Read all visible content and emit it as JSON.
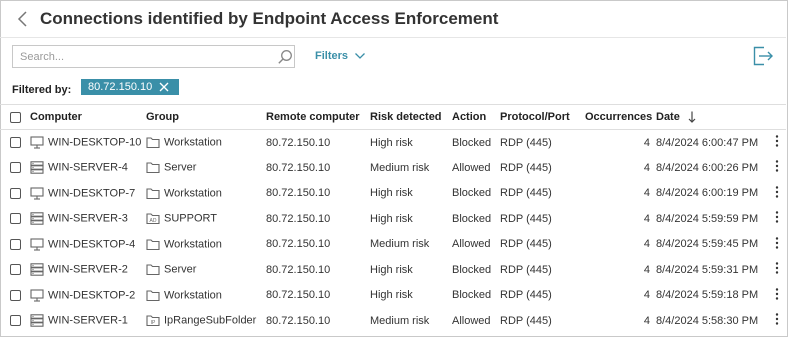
{
  "header": {
    "title": "Connections identified by Endpoint Access Enforcement",
    "back_icon": "chevron-left-icon"
  },
  "toolbar": {
    "search_placeholder": "Search...",
    "search_icon": "search-icon",
    "filters_label": "Filters",
    "filters_icon": "chevron-down-icon",
    "export_icon": "export-icon"
  },
  "filter_bar": {
    "label": "Filtered by:",
    "chip": "80.72.150.10",
    "chip_remove_icon": "close-icon"
  },
  "table": {
    "columns": [
      "Computer",
      "Group",
      "Remote computer",
      "Risk detected",
      "Action",
      "Protocol/Port",
      "Occurrences",
      "Date"
    ],
    "sort_column": "Date",
    "sort_direction": "descending",
    "rows": [
      {
        "computer": "WIN-DESKTOP-10",
        "computer_type": "desktop",
        "group": "Workstation",
        "group_type": "folder",
        "remote": "80.72.150.10",
        "risk": "High risk",
        "action": "Blocked",
        "protocol": "RDP (445)",
        "occurrences": "4",
        "date": "8/4/2024 6:00:47 PM"
      },
      {
        "computer": "WIN-SERVER-4",
        "computer_type": "server",
        "group": "Server",
        "group_type": "folder",
        "remote": "80.72.150.10",
        "risk": "Medium risk",
        "action": "Allowed",
        "protocol": "RDP (445)",
        "occurrences": "4",
        "date": "8/4/2024 6:00:26 PM"
      },
      {
        "computer": "WIN-DESKTOP-7",
        "computer_type": "desktop",
        "group": "Workstation",
        "group_type": "folder",
        "remote": "80.72.150.10",
        "risk": "High risk",
        "action": "Blocked",
        "protocol": "RDP (445)",
        "occurrences": "4",
        "date": "8/4/2024 6:00:19 PM"
      },
      {
        "computer": "WIN-SERVER-3",
        "computer_type": "server",
        "group": "SUPPORT",
        "group_type": "ad",
        "remote": "80.72.150.10",
        "risk": "High risk",
        "action": "Blocked",
        "protocol": "RDP (445)",
        "occurrences": "4",
        "date": "8/4/2024 5:59:59 PM"
      },
      {
        "computer": "WIN-DESKTOP-4",
        "computer_type": "desktop",
        "group": "Workstation",
        "group_type": "folder",
        "remote": "80.72.150.10",
        "risk": "Medium risk",
        "action": "Allowed",
        "protocol": "RDP (445)",
        "occurrences": "4",
        "date": "8/4/2024 5:59:45 PM"
      },
      {
        "computer": "WIN-SERVER-2",
        "computer_type": "server",
        "group": "Server",
        "group_type": "folder",
        "remote": "80.72.150.10",
        "risk": "High risk",
        "action": "Blocked",
        "protocol": "RDP (445)",
        "occurrences": "4",
        "date": "8/4/2024 5:59:31 PM"
      },
      {
        "computer": "WIN-DESKTOP-2",
        "computer_type": "desktop",
        "group": "Workstation",
        "group_type": "folder",
        "remote": "80.72.150.10",
        "risk": "High risk",
        "action": "Blocked",
        "protocol": "RDP (445)",
        "occurrences": "4",
        "date": "8/4/2024 5:59:18 PM"
      },
      {
        "computer": "WIN-SERVER-1",
        "computer_type": "server",
        "group": "IpRangeSubFolder",
        "group_type": "iprange",
        "remote": "80.72.150.10",
        "risk": "Medium risk",
        "action": "Allowed",
        "protocol": "RDP (445)",
        "occurrences": "4",
        "date": "8/4/2024 5:58:30 PM"
      }
    ]
  },
  "colors": {
    "accent": "#3a8fa8",
    "icon_gray": "#666666",
    "text": "#222222",
    "border": "#dedede"
  }
}
